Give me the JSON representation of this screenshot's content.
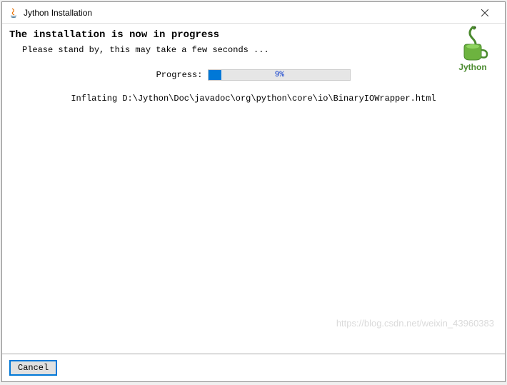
{
  "window": {
    "title": "Jython Installation"
  },
  "header": {
    "heading": "The installation is now in progress",
    "subheading": "Please stand by, this may take a few seconds ..."
  },
  "progress": {
    "label": "Progress:",
    "percent_text": "9%",
    "percent_value": 9
  },
  "status": {
    "text": "Inflating D:\\Jython\\Doc\\javadoc\\org\\python\\core\\io\\BinaryIOWrapper.html"
  },
  "footer": {
    "cancel_label": "Cancel"
  },
  "logo": {
    "name": "Jython"
  },
  "watermark": "https://blog.csdn.net/weixin_43960383"
}
